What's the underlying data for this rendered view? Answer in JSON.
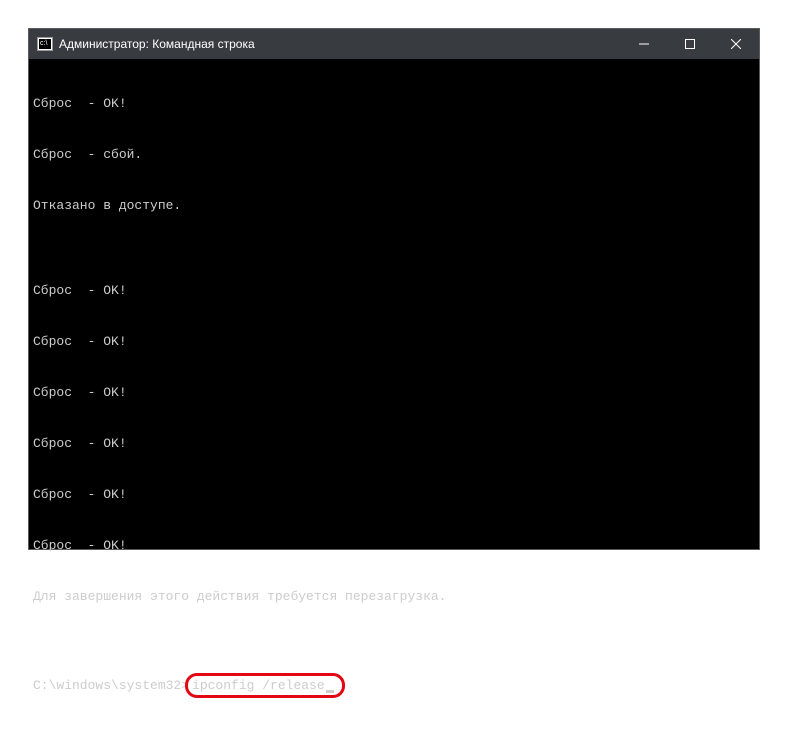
{
  "titlebar": {
    "title": "Администратор: Командная строка"
  },
  "output": {
    "line1": "Сброс  - OK!",
    "line2": "Сброс  - сбой.",
    "line3": "Отказано в доступе.",
    "line4": "",
    "line5": "Сброс  - OK!",
    "line6": "Сброс  - OK!",
    "line7": "Сброс  - OK!",
    "line8": "Сброс  - OK!",
    "line9": "Сброс  - OK!",
    "line10": "Сброс  - OK!",
    "line11": "Для завершения этого действия требуется перезагрузка.",
    "line12": ""
  },
  "prompt": {
    "path": "C:\\windows\\system32>",
    "command": "ipconfig /release"
  }
}
